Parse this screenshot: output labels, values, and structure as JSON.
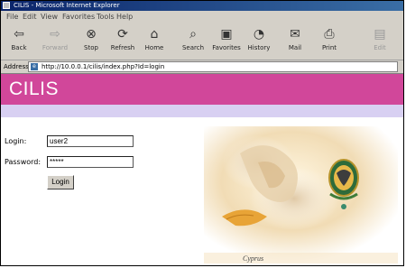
{
  "window": {
    "title": "CILIS - Microsoft Internet Explorer"
  },
  "menu": {
    "items": [
      "File",
      "Edit",
      "View",
      "Favorites",
      "Tools",
      "Help"
    ]
  },
  "toolbar": {
    "buttons": [
      {
        "label": "Back",
        "icon": "back-arrow-icon"
      },
      {
        "label": "Forward",
        "icon": "forward-arrow-icon"
      },
      {
        "label": "Stop",
        "icon": "stop-icon"
      },
      {
        "label": "Refresh",
        "icon": "refresh-icon"
      },
      {
        "label": "Home",
        "icon": "home-icon"
      },
      {
        "label": "Search",
        "icon": "search-icon"
      },
      {
        "label": "Favorites",
        "icon": "favorites-icon"
      },
      {
        "label": "History",
        "icon": "history-icon"
      },
      {
        "label": "Mail",
        "icon": "mail-icon"
      },
      {
        "label": "Print",
        "icon": "print-icon"
      },
      {
        "label": "Edit",
        "icon": "edit-icon"
      }
    ]
  },
  "address": {
    "label": "Address",
    "url": "http://10.0.0.1/cilis/index.php?Id=login"
  },
  "banner": {
    "title": "CILIS",
    "color": "#d1479a"
  },
  "login": {
    "login_label": "Login:",
    "login_value": "user2",
    "password_label": "Password:",
    "password_value": "*****",
    "button_label": "Login"
  },
  "art": {
    "caption": "Cyprus"
  }
}
